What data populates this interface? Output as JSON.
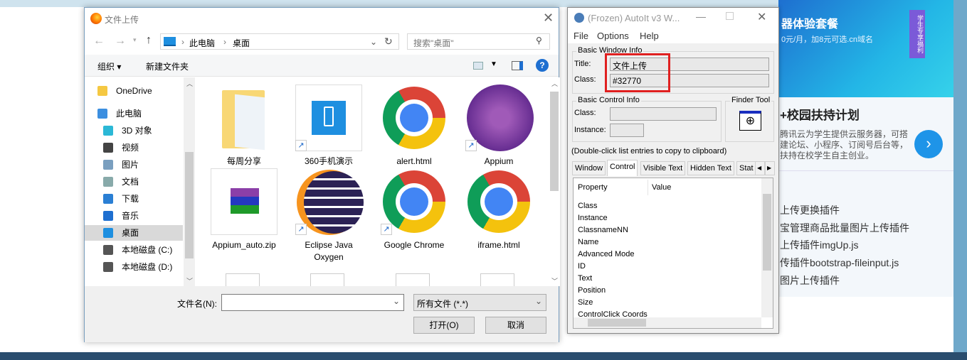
{
  "file_dialog": {
    "title": "文件上传",
    "address": {
      "parts": [
        "此电脑",
        "桌面"
      ]
    },
    "search_placeholder": "搜索\"桌面\"",
    "toolbar": {
      "organize": "组织 ▾",
      "new_folder": "新建文件夹"
    },
    "nav_items": [
      {
        "label": "OneDrive",
        "icon": "folder-icon",
        "color": "#f5c842"
      },
      {
        "label": "此电脑",
        "icon": "computer-icon",
        "color": "#3c8fe0"
      },
      {
        "label": "3D 对象",
        "icon": "cube-icon",
        "color": "#2bb8d6"
      },
      {
        "label": "视频",
        "icon": "film-icon",
        "color": "#444"
      },
      {
        "label": "图片",
        "icon": "picture-icon",
        "color": "#7a9fbf"
      },
      {
        "label": "文档",
        "icon": "document-icon",
        "color": "#8aa"
      },
      {
        "label": "下载",
        "icon": "download-icon",
        "color": "#2a7fd4"
      },
      {
        "label": "音乐",
        "icon": "music-icon",
        "color": "#1e6fd0"
      },
      {
        "label": "桌面",
        "icon": "desktop-icon",
        "color": "#1e8fe0",
        "selected": true
      },
      {
        "label": "本地磁盘 (C:)",
        "icon": "drive-icon",
        "color": "#555"
      },
      {
        "label": "本地磁盘 (D:)",
        "icon": "drive-icon",
        "color": "#555"
      }
    ],
    "files": [
      {
        "name": "每周分享",
        "icon": "folder-icon"
      },
      {
        "name": "360手机演示",
        "icon": "phone-app-icon",
        "shortcut": true
      },
      {
        "name": "alert.html",
        "icon": "chrome-icon"
      },
      {
        "name": "Appium",
        "icon": "appium-icon",
        "shortcut": true
      },
      {
        "name": "Appium_auto.zip",
        "icon": "winrar-icon"
      },
      {
        "name": "Eclipse Java Oxygen",
        "icon": "eclipse-icon",
        "shortcut": true
      },
      {
        "name": "Google Chrome",
        "icon": "chrome-icon",
        "shortcut": true
      },
      {
        "name": "iframe.html",
        "icon": "chrome-icon"
      }
    ],
    "filename_label": "文件名(N):",
    "filename_value": "",
    "filetype": "所有文件 (*.*)",
    "open_button": "打开(O)",
    "cancel_button": "取消"
  },
  "autoit": {
    "title": "(Frozen) AutoIt v3 W...",
    "menu": [
      "File",
      "Options",
      "Help"
    ],
    "basic_window_info": "Basic Window Info",
    "title_label": "Title:",
    "title_value": "文件上传",
    "class_label": "Class:",
    "class_value": "#32770",
    "basic_control_info": "Basic Control Info",
    "ctrl_class_label": "Class:",
    "instance_label": "Instance:",
    "finder_tool": "Finder Tool",
    "hint": "(Double-click list entries to copy to clipboard)",
    "tabs": [
      "Window",
      "Control",
      "Visible Text",
      "Hidden Text",
      "Stat"
    ],
    "active_tab": "Control",
    "columns": [
      "Property",
      "Value"
    ],
    "properties": [
      "Class",
      "Instance",
      "ClassnameNN",
      "Name",
      "Advanced Mode",
      "ID",
      "Text",
      "Position",
      "Size",
      "ControlClick Coords"
    ],
    "highlight_color": "#e02020"
  },
  "web": {
    "banner_title": "器体验套餐",
    "banner_sub": "0元/月，加8元可选.cn域名",
    "banner_tag": "学生专享福利",
    "heading": "+校园扶持计划",
    "desc": "腾讯云为学生提供云服务器，可搭建论坛、小程序、订阅号后台等，扶持在校学生自主创业。",
    "links": [
      "上传更换插件",
      "宝管理商品批量图片上传插件",
      "上传插件imgUp.js",
      "传插件bootstrap-fileinput.js",
      "图片上传插件"
    ]
  }
}
